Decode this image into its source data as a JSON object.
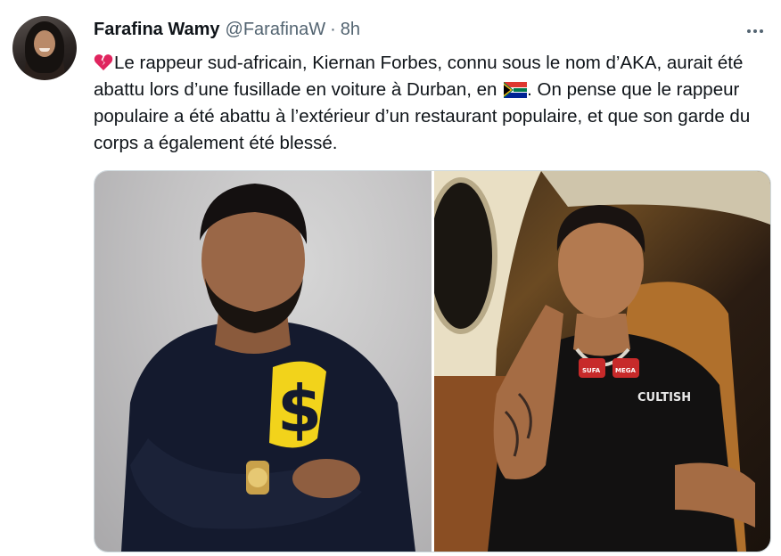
{
  "tweet": {
    "author_name": "Farafina Wamy",
    "handle": "@FarafinaW",
    "separator": "·",
    "time": "8h",
    "text_main": "Le rappeur sud-africain, Kiernan Forbes, connu sous le nom d’AKA, aurait été abattu lors d’une fusillade en voiture à Durban, en",
    "text_tail": ". On pense que le rappeur populaire a été abattu à l’extérieur d’un restaurant populaire, et que son garde du corps a également été blessé.",
    "leading_emoji": "broken-heart-icon",
    "inline_flag": "south-africa-flag-icon",
    "photo_text": {
      "shirt_symbol": "$",
      "necklace_left": "SUFA",
      "necklace_right": "MEGA",
      "tshirt": "CULTISH"
    }
  },
  "icons": {
    "more": "more-horizontal-icon"
  },
  "colors": {
    "text": "#0f1419",
    "secondary": "#536471",
    "border": "#cfd9de",
    "heart": "#e0245e"
  }
}
